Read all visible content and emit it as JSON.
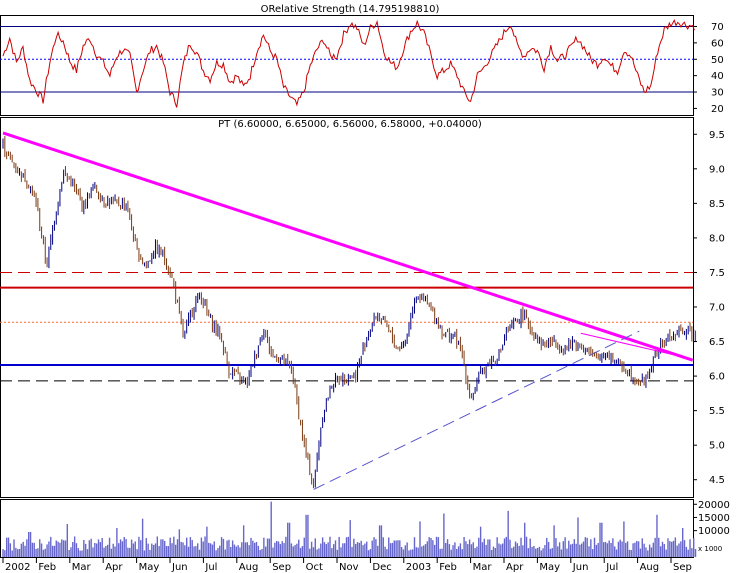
{
  "rsi_panel": {
    "title": "ORelative Strength (14.795198810)",
    "y_ticks": [
      20,
      30,
      40,
      50,
      60,
      70
    ],
    "ylim": [
      16,
      77
    ],
    "overbought": 70,
    "midline": 50,
    "oversold": 30,
    "color": "#cc0000"
  },
  "price_panel": {
    "title": "PT (6.60000, 6.65000, 6.56000, 6.58000, +0.04000)",
    "y_ticks": [
      4.5,
      5.0,
      5.5,
      6.0,
      6.5,
      7.0,
      7.5,
      8.0,
      8.5,
      9.0,
      9.5
    ],
    "ylim": [
      4.25,
      9.75
    ],
    "up_color": "#000080",
    "down_color": "#7a3a12",
    "downtrend_color": "#ff00ff",
    "resistance_color": "#cc0000",
    "support_color": "#0000cc"
  },
  "volume_panel": {
    "y_ticks": [
      10000,
      15000,
      20000
    ],
    "unit_label": "x 1000",
    "ylim": [
      0,
      22000
    ],
    "color": "#6666cc"
  },
  "x_axis": {
    "labels": [
      "2002",
      "Feb",
      "Mar",
      "Apr",
      "May",
      "Jun",
      "Jul",
      "Aug",
      "Sep",
      "Oct",
      "Nov",
      "Dec",
      "2003",
      "Feb",
      "Mar",
      "Apr",
      "May",
      "Jun",
      "Jul",
      "Aug",
      "Sep"
    ]
  },
  "chart_data": {
    "type": "candlestick",
    "symbol": "PT",
    "last_bar": {
      "open": 6.6,
      "high": 6.65,
      "low": 6.56,
      "close": 6.58,
      "change": 0.04
    },
    "x_labels": [
      "2002",
      "Feb",
      "Mar",
      "Apr",
      "May",
      "Jun",
      "Jul",
      "Aug",
      "Sep",
      "Oct",
      "Nov",
      "Dec",
      "2003",
      "Feb",
      "Mar",
      "Apr",
      "May",
      "Jun",
      "Jul",
      "Aug",
      "Sep"
    ],
    "price_close_path": [
      [
        0.0,
        9.35
      ],
      [
        0.25,
        9.1
      ],
      [
        0.5,
        8.95
      ],
      [
        0.75,
        8.8
      ],
      [
        1.0,
        8.5
      ],
      [
        1.3,
        7.6
      ],
      [
        1.55,
        8.3
      ],
      [
        1.8,
        8.95
      ],
      [
        2.05,
        8.8
      ],
      [
        2.4,
        8.45
      ],
      [
        2.7,
        8.75
      ],
      [
        3.0,
        8.55
      ],
      [
        3.3,
        8.5
      ],
      [
        3.7,
        8.5
      ],
      [
        4.0,
        7.8
      ],
      [
        4.3,
        7.6
      ],
      [
        4.55,
        7.85
      ],
      [
        4.8,
        7.75
      ],
      [
        5.1,
        7.35
      ],
      [
        5.4,
        6.55
      ],
      [
        5.65,
        6.95
      ],
      [
        5.9,
        7.2
      ],
      [
        6.2,
        6.8
      ],
      [
        6.5,
        6.6
      ],
      [
        6.75,
        6.1
      ],
      [
        7.0,
        6.0
      ],
      [
        7.3,
        5.9
      ],
      [
        7.55,
        6.3
      ],
      [
        7.8,
        6.7
      ],
      [
        8.05,
        6.3
      ],
      [
        8.35,
        6.25
      ],
      [
        8.65,
        6.1
      ],
      [
        8.9,
        5.3
      ],
      [
        9.1,
        4.8
      ],
      [
        9.3,
        4.4
      ],
      [
        9.55,
        5.4
      ],
      [
        9.85,
        5.9
      ],
      [
        10.2,
        6.0
      ],
      [
        10.55,
        6.0
      ],
      [
        10.9,
        6.6
      ],
      [
        11.2,
        6.9
      ],
      [
        11.5,
        6.7
      ],
      [
        11.8,
        6.4
      ],
      [
        12.05,
        6.5
      ],
      [
        12.35,
        7.2
      ],
      [
        12.6,
        7.1
      ],
      [
        12.9,
        6.9
      ],
      [
        13.2,
        6.6
      ],
      [
        13.5,
        6.6
      ],
      [
        13.75,
        6.3
      ],
      [
        14.0,
        5.65
      ],
      [
        14.25,
        6.0
      ],
      [
        14.55,
        6.2
      ],
      [
        14.85,
        6.3
      ],
      [
        15.05,
        6.6
      ],
      [
        15.3,
        6.75
      ],
      [
        15.55,
        6.9
      ],
      [
        15.85,
        6.65
      ],
      [
        16.15,
        6.45
      ],
      [
        16.45,
        6.5
      ],
      [
        16.8,
        6.4
      ],
      [
        17.1,
        6.5
      ],
      [
        17.4,
        6.4
      ],
      [
        17.75,
        6.25
      ],
      [
        18.05,
        6.35
      ],
      [
        18.35,
        6.2
      ],
      [
        18.65,
        6.1
      ],
      [
        18.95,
        5.95
      ],
      [
        19.2,
        5.92
      ],
      [
        19.45,
        6.2
      ],
      [
        19.7,
        6.45
      ],
      [
        19.9,
        6.55
      ],
      [
        20.15,
        6.6
      ],
      [
        20.45,
        6.68
      ],
      [
        20.75,
        6.58
      ]
    ],
    "rsi_path": [
      [
        0.0,
        52
      ],
      [
        0.2,
        63
      ],
      [
        0.4,
        48
      ],
      [
        0.6,
        57
      ],
      [
        0.8,
        37
      ],
      [
        1.2,
        25
      ],
      [
        1.4,
        48
      ],
      [
        1.6,
        65
      ],
      [
        1.8,
        61
      ],
      [
        2.0,
        49
      ],
      [
        2.2,
        43
      ],
      [
        2.4,
        58
      ],
      [
        2.6,
        63
      ],
      [
        2.8,
        53
      ],
      [
        3.0,
        48
      ],
      [
        3.2,
        40
      ],
      [
        3.4,
        52
      ],
      [
        3.6,
        56
      ],
      [
        3.8,
        52
      ],
      [
        4.0,
        30
      ],
      [
        4.2,
        44
      ],
      [
        4.4,
        55
      ],
      [
        4.6,
        58
      ],
      [
        4.8,
        48
      ],
      [
        5.0,
        30
      ],
      [
        5.2,
        23
      ],
      [
        5.4,
        47
      ],
      [
        5.6,
        60
      ],
      [
        5.8,
        54
      ],
      [
        6.0,
        43
      ],
      [
        6.2,
        38
      ],
      [
        6.4,
        48
      ],
      [
        6.6,
        47
      ],
      [
        6.8,
        36
      ],
      [
        7.0,
        40
      ],
      [
        7.2,
        33
      ],
      [
        7.4,
        40
      ],
      [
        7.6,
        55
      ],
      [
        7.8,
        65
      ],
      [
        8.0,
        55
      ],
      [
        8.2,
        50
      ],
      [
        8.4,
        33
      ],
      [
        8.6,
        27
      ],
      [
        8.8,
        22
      ],
      [
        9.0,
        30
      ],
      [
        9.2,
        46
      ],
      [
        9.4,
        56
      ],
      [
        9.6,
        62
      ],
      [
        9.8,
        52
      ],
      [
        10.0,
        52
      ],
      [
        10.2,
        65
      ],
      [
        10.4,
        72
      ],
      [
        10.6,
        69
      ],
      [
        10.8,
        58
      ],
      [
        11.0,
        69
      ],
      [
        11.2,
        73
      ],
      [
        11.4,
        55
      ],
      [
        11.6,
        48
      ],
      [
        11.8,
        45
      ],
      [
        12.0,
        57
      ],
      [
        12.2,
        67
      ],
      [
        12.4,
        72
      ],
      [
        12.6,
        66
      ],
      [
        12.8,
        53
      ],
      [
        13.0,
        40
      ],
      [
        13.2,
        43
      ],
      [
        13.4,
        47
      ],
      [
        13.6,
        40
      ],
      [
        13.8,
        30
      ],
      [
        14.0,
        24
      ],
      [
        14.2,
        40
      ],
      [
        14.4,
        45
      ],
      [
        14.6,
        52
      ],
      [
        14.8,
        59
      ],
      [
        15.0,
        66
      ],
      [
        15.2,
        72
      ],
      [
        15.4,
        58
      ],
      [
        15.6,
        52
      ],
      [
        15.8,
        57
      ],
      [
        16.0,
        55
      ],
      [
        16.2,
        45
      ],
      [
        16.4,
        58
      ],
      [
        16.6,
        49
      ],
      [
        16.8,
        52
      ],
      [
        17.0,
        57
      ],
      [
        17.2,
        63
      ],
      [
        17.4,
        57
      ],
      [
        17.6,
        50
      ],
      [
        17.8,
        47
      ],
      [
        18.0,
        52
      ],
      [
        18.2,
        46
      ],
      [
        18.4,
        43
      ],
      [
        18.6,
        56
      ],
      [
        18.8,
        52
      ],
      [
        19.0,
        40
      ],
      [
        19.2,
        30
      ],
      [
        19.4,
        34
      ],
      [
        19.6,
        55
      ],
      [
        19.8,
        68
      ],
      [
        20.0,
        72
      ],
      [
        20.2,
        73
      ],
      [
        20.45,
        71
      ],
      [
        20.75,
        70
      ]
    ],
    "trendlines": [
      {
        "kind": "downtrend",
        "from": [
          0.0,
          9.52
        ],
        "to": [
          20.65,
          6.23
        ]
      },
      {
        "kind": "uptrend",
        "from": [
          9.3,
          4.36
        ],
        "to": [
          19.05,
          6.65
        ]
      }
    ],
    "horizontal_levels": [
      {
        "value": 7.5,
        "style": "dashed",
        "kind": "resistance"
      },
      {
        "value": 7.28,
        "style": "solid",
        "kind": "resistance"
      },
      {
        "value": 6.78,
        "style": "dotted",
        "kind": "resistance"
      },
      {
        "value": 6.16,
        "style": "solid",
        "kind": "support"
      },
      {
        "value": 5.93,
        "style": "dashed",
        "kind": "support"
      }
    ],
    "volume_typical": 6000,
    "volume_spikes": [
      [
        0.8,
        9500
      ],
      [
        1.9,
        12500
      ],
      [
        3.4,
        11000
      ],
      [
        4.2,
        14500
      ],
      [
        5.3,
        10500
      ],
      [
        6.1,
        11500
      ],
      [
        7.2,
        12000
      ],
      [
        8.05,
        21000
      ],
      [
        8.55,
        13000
      ],
      [
        9.1,
        16000
      ],
      [
        10.4,
        14000
      ],
      [
        11.3,
        12000
      ],
      [
        12.5,
        13500
      ],
      [
        13.2,
        16500
      ],
      [
        14.3,
        11500
      ],
      [
        15.1,
        17500
      ],
      [
        15.6,
        13000
      ],
      [
        16.5,
        12000
      ],
      [
        17.2,
        15000
      ],
      [
        17.9,
        13000
      ],
      [
        18.6,
        13500
      ],
      [
        19.6,
        16000
      ],
      [
        20.35,
        11000
      ]
    ]
  }
}
